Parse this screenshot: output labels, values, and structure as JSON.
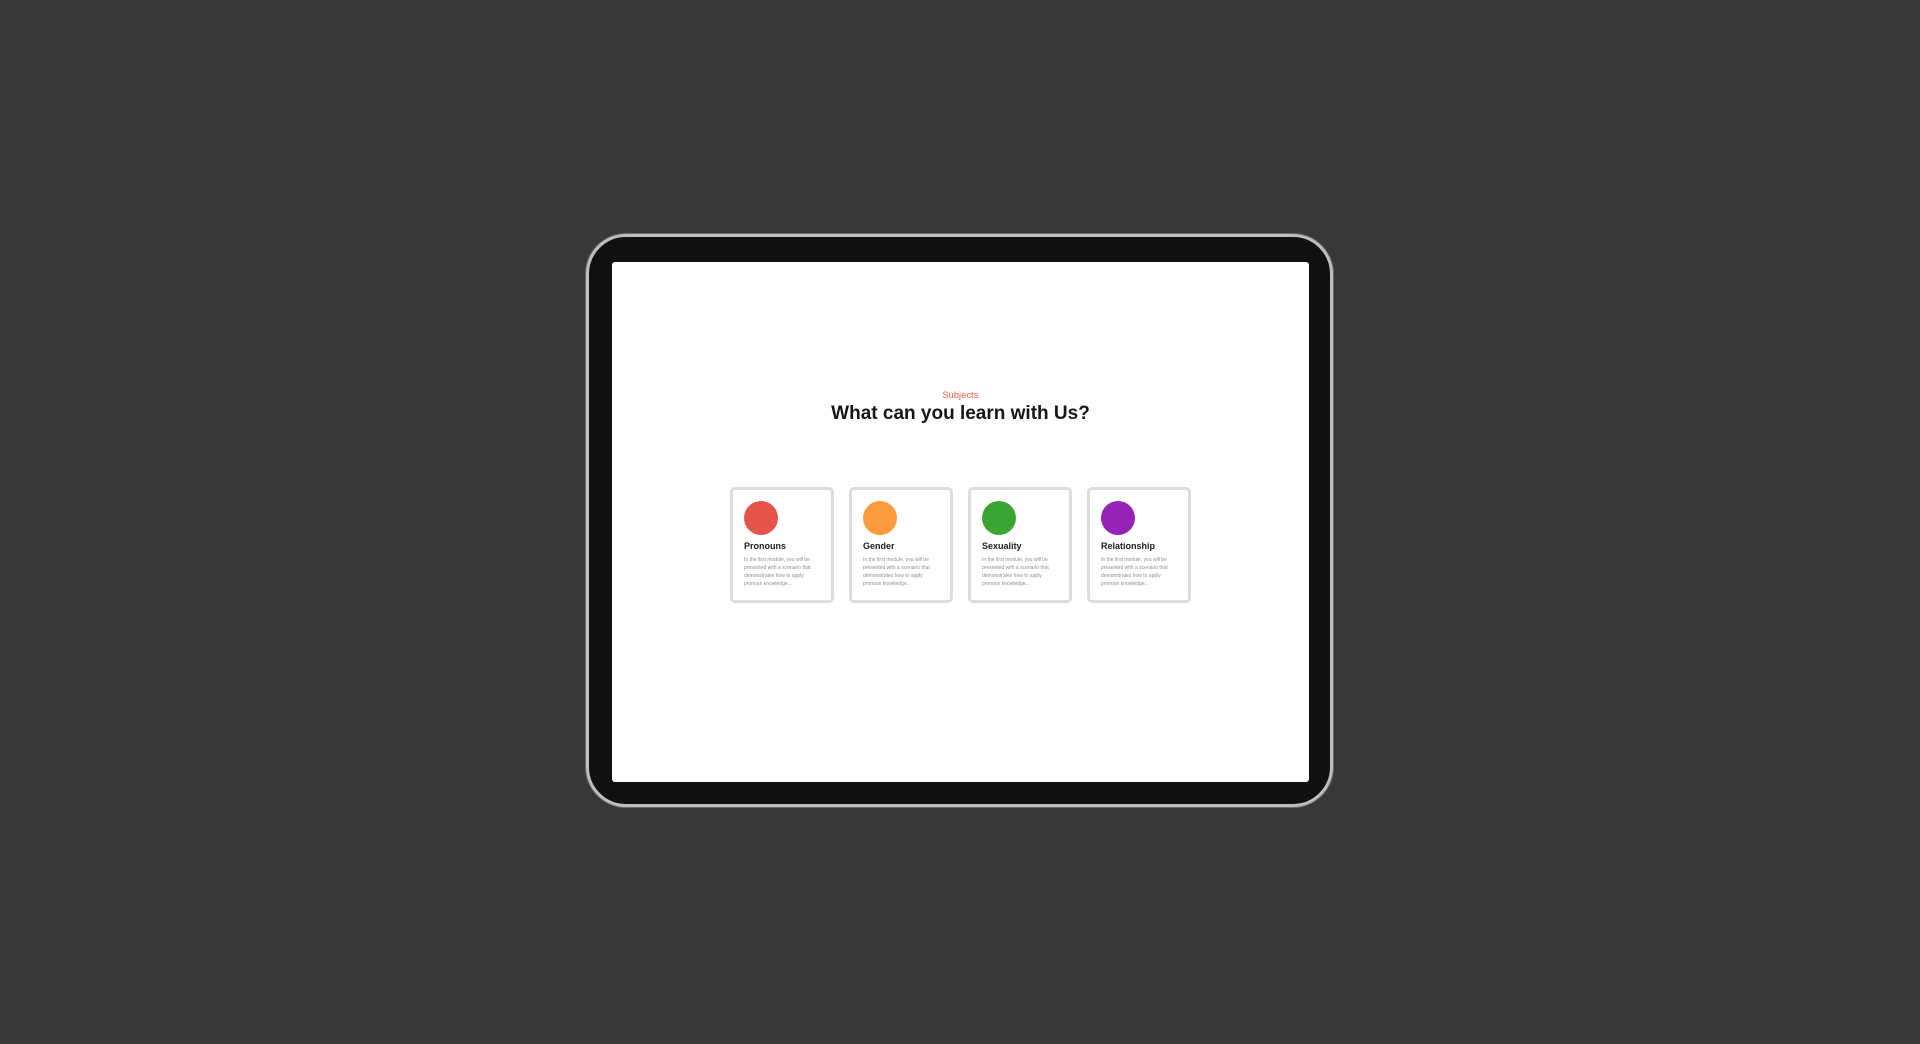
{
  "section": {
    "eyebrow": "Subjects",
    "headline": "What can you learn with Us?"
  },
  "cards": [
    {
      "title": "Pronouns",
      "description": "In the first module, you will be presented with a scenario that demonstrates how to apply pronoun knowledge...",
      "color": "#e5534b",
      "icon": "red-circle-icon"
    },
    {
      "title": "Gender",
      "description": "In the first module, you will be presented with a scenario that demonstrates how to apply pronoun knowledge...",
      "color": "#ff9a3d",
      "icon": "orange-circle-icon"
    },
    {
      "title": "Sexuality",
      "description": "In the first module, you will be presented with a scenario that demonstrates how to apply pronoun knowledge...",
      "color": "#3aa535",
      "icon": "green-circle-icon"
    },
    {
      "title": "Relationship",
      "description": "In the first module, you will be presented with a scenario that demonstrates how to apply pronoun knowledge...",
      "color": "#9623b8",
      "icon": "purple-circle-icon"
    }
  ],
  "colors": {
    "background": "#383838",
    "accent": "#ff5a3c",
    "screen": "#ffffff"
  }
}
